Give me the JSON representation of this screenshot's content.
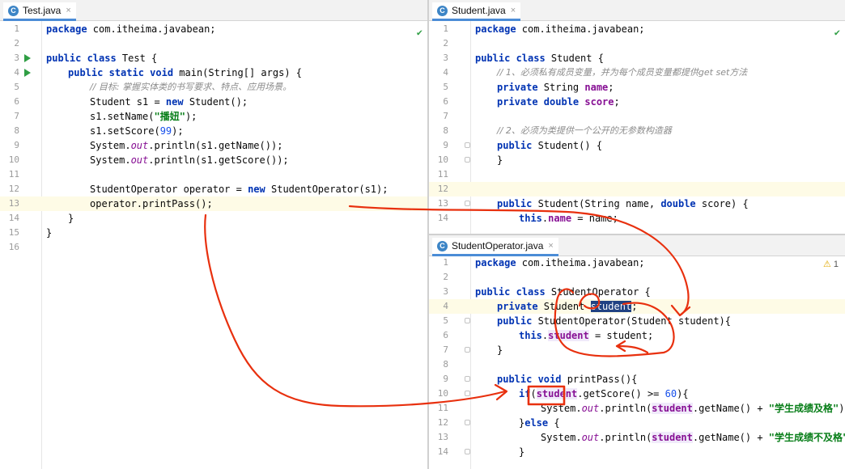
{
  "left_tab": {
    "label": "Test.java",
    "close": "×"
  },
  "right_top_tab": {
    "label": "Student.java",
    "close": "×"
  },
  "right_bottom_tab": {
    "label": "StudentOperator.java",
    "close": "×"
  },
  "warning": {
    "icon": "⚠",
    "count": "1"
  },
  "test_lines": [
    "1",
    "2",
    "3",
    "4",
    "5",
    "6",
    "7",
    "8",
    "9",
    "10",
    "11",
    "12",
    "13",
    "14",
    "15",
    "16"
  ],
  "test_code": {
    "l1_kw": "package",
    "l1_rest": " com.itheima.javabean;",
    "l3_kw": "public class",
    "l3_rest": " Test {",
    "l4_kw": "public static void",
    "l4_rest": " main(String[] args) {",
    "l5": "// 目标: 掌握实体类的书写要求、特点、应用场景。",
    "l6_a": "Student s1 = ",
    "l6_kw": "new",
    "l6_b": " Student();",
    "l7_a": "s1.setName(",
    "l7_str": "\"播妞\"",
    "l7_b": ");",
    "l8_a": "s1.setScore(",
    "l8_num": "99",
    "l8_b": ");",
    "l9_a": "System.",
    "l9_st": "out",
    "l9_b": ".println(s1.getName());",
    "l10_a": "System.",
    "l10_st": "out",
    "l10_b": ".println(s1.getScore());",
    "l12_a": "StudentOperator operator = ",
    "l12_kw": "new",
    "l12_b": " StudentOperator(s1);",
    "l13": "operator.printPass();",
    "l14": "}",
    "l15": "}"
  },
  "student_lines": [
    "1",
    "2",
    "3",
    "4",
    "5",
    "6",
    "7",
    "8",
    "9",
    "10",
    "11",
    "12",
    "13",
    "14"
  ],
  "student_code": {
    "l1_kw": "package",
    "l1_rest": " com.itheima.javabean;",
    "l3_kw": "public class",
    "l3_rest": " Student {",
    "l4": "// 1、必须私有成员变量，并为每个成员变量都提供get set方法",
    "l5_kw": "private",
    "l5_a": " String ",
    "l5_f": "name",
    "l5_b": ";",
    "l6_kw": "private double",
    "l6_f": " score",
    "l6_b": ";",
    "l8": "// 2、必须为类提供一个公开的无参数构造器",
    "l9_kw": "public",
    "l9_rest": " Student() {",
    "l10": "}",
    "l13_kw": "public",
    "l13_a": " Student(String name, ",
    "l13_kw2": "double",
    "l13_b": " score) {",
    "l14_kw": "this",
    "l14_a": ".",
    "l14_f": "name",
    "l14_b": " = name;"
  },
  "operator_lines": [
    "1",
    "2",
    "3",
    "4",
    "5",
    "6",
    "7",
    "8",
    "9",
    "10",
    "11",
    "12",
    "13",
    "14"
  ],
  "operator_code": {
    "l1_kw": "package",
    "l1_rest": " com.itheima.javabean;",
    "l3_kw": "public class",
    "l3_rest": " StudentOperator {",
    "l4_kw": "private",
    "l4_a": " Student ",
    "l4_sel": "student",
    "l4_b": ";",
    "l5_kw": "public",
    "l5_rest": " StudentOperator(Student student){",
    "l6_kw": "this",
    "l6_a": ".",
    "l6_f": "student",
    "l6_b": " = student;",
    "l7": "}",
    "l9_kw": "public void",
    "l9_rest": " printPass(){",
    "l10_kw": "if",
    "l10_a": "(",
    "l10_f": "student",
    "l10_b": ".getScore() >= ",
    "l10_num": "60",
    "l10_c": "){",
    "l11_a": "System.",
    "l11_st": "out",
    "l11_b": ".println(",
    "l11_f": "student",
    "l11_c": ".getName() + ",
    "l11_str": "\"学生成绩及格\"",
    "l11_d": ");",
    "l12_a": "}",
    "l12_kw": "else",
    "l12_b": " {",
    "l13_a": "System.",
    "l13_st": "out",
    "l13_b": ".println(",
    "l13_f": "student",
    "l13_c": ".getName() + ",
    "l13_str": "\"学生成绩不及格\"",
    "l13_d": ");",
    "l14": "}"
  },
  "colors": {
    "annotation": "#e8300e",
    "keyword": "#0033b3",
    "string": "#067d17",
    "field": "#871094"
  }
}
